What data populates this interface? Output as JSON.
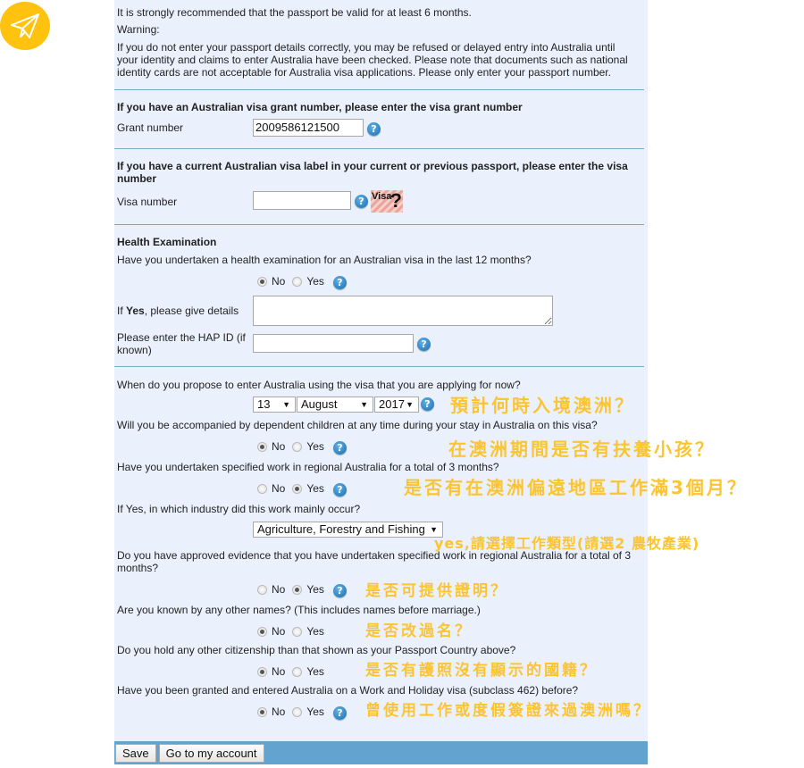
{
  "intro": {
    "recommendation": "It is strongly recommended that the passport be valid for at least 6 months.",
    "warning_label": "Warning:",
    "warning_line1": "If you do not enter your passport details correctly, you may be refused or delayed entry into Australia until",
    "warning_line2": "your identity and claims to enter Australia have been checked. Please note that documents such as national",
    "warning_line3": "identity cards are not acceptable for Australia visa applications. Please only enter your passport number."
  },
  "grant": {
    "heading": "If you have an Australian visa grant number, please enter the visa grant number",
    "label": "Grant number",
    "value": "2009586121500"
  },
  "visa_label": {
    "heading_line1": "If you have a current Australian visa label in your current or previous passport, please enter the visa",
    "heading_line2": "number",
    "label": "Visa number",
    "value": "",
    "image_text": "Visa",
    "image_glyph": "?"
  },
  "health": {
    "heading": "Health Examination",
    "question": "Have you undertaken a health examination for an Australian visa in the last 12 months?",
    "selected": "No",
    "details_prefix": "If ",
    "details_bold": "Yes",
    "details_suffix": ", please give details",
    "details_value": "",
    "hap_label_line1": "Please enter the HAP ID (if",
    "hap_label_line2": "known)",
    "hap_value": ""
  },
  "options": {
    "no": "No",
    "yes": "Yes"
  },
  "entry": {
    "question": "When do you propose to enter Australia using the visa that you are applying for now?",
    "day": "13",
    "month": "August",
    "year": "2017",
    "note": "預計何時入境澳洲？"
  },
  "children": {
    "question": "Will you be accompanied by dependent children at any time during your stay in Australia on this visa?",
    "selected": "No",
    "note": "在澳洲期間是否有扶養小孩？"
  },
  "regional_work": {
    "question": "Have you undertaken specified work in regional Australia for a total of 3 months?",
    "selected": "Yes",
    "note": "是否有在澳洲偏遠地區工作滿3個月？"
  },
  "industry": {
    "question": "If Yes, in which industry did this work mainly occur?",
    "value": "Agriculture, Forestry and Fishing",
    "note": "yes,請選擇工作類型(請選2 農牧產業)"
  },
  "evidence": {
    "question_line1": "Do you have approved evidence that you have undertaken specified work in regional Australia for a total of 3",
    "question_line2": "months?",
    "selected": "Yes",
    "note": "是否可提供證明？"
  },
  "other_names": {
    "question": "Are you known by any other names? (This includes names before marriage.)",
    "selected": "No",
    "note": "是否改過名？"
  },
  "citizenship": {
    "question": "Do you hold any other citizenship than that shown as your Passport Country above?",
    "selected": "No",
    "note": "是否有護照沒有顯示的國籍？"
  },
  "whv": {
    "question": "Have you been granted and entered Australia on a Work and Holiday visa (subclass 462) before?",
    "selected": "No",
    "note": "曾使用工作或度假簽證來過澳洲嗎？"
  },
  "footer": {
    "save_label": "Save",
    "account_label": "Go to my account"
  },
  "colors": {
    "panel_bg": "#eaf1fc",
    "footer_bg": "#62a4cf",
    "annotation": "#fcc431",
    "logo": "#ffc20e"
  }
}
